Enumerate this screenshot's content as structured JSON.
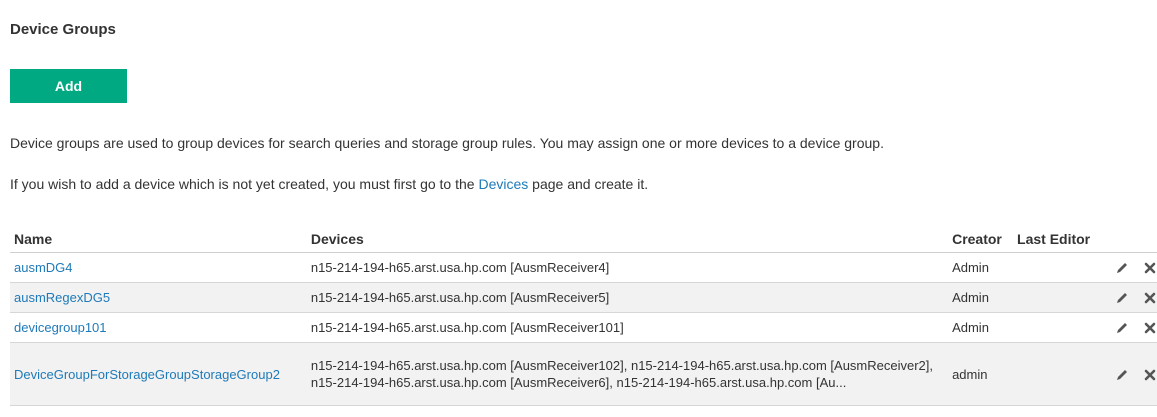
{
  "page": {
    "title": "Device Groups",
    "add_label": "Add",
    "desc1": "Device groups are used to group devices for search queries and storage group rules. You may assign one or more devices to a device group.",
    "desc2_pre": "If you wish to add a device which is not yet created, you must first go to the ",
    "desc2_link": "Devices",
    "desc2_post": " page and create it."
  },
  "table": {
    "headers": {
      "name": "Name",
      "devices": "Devices",
      "creator": "Creator",
      "last_editor": "Last Editor"
    },
    "rows": [
      {
        "name": "ausmDG4",
        "devices": "n15-214-194-h65.arst.usa.hp.com [AusmReceiver4]",
        "creator": "Admin",
        "last_editor": ""
      },
      {
        "name": "ausmRegexDG5",
        "devices": "n15-214-194-h65.arst.usa.hp.com [AusmReceiver5]",
        "creator": "Admin",
        "last_editor": ""
      },
      {
        "name": "devicegroup101",
        "devices": "n15-214-194-h65.arst.usa.hp.com [AusmReceiver101]",
        "creator": "Admin",
        "last_editor": ""
      },
      {
        "name": "DeviceGroupForStorageGroupStorageGroup2",
        "devices": "n15-214-194-h65.arst.usa.hp.com [AusmReceiver102], n15-214-194-h65.arst.usa.hp.com [AusmReceiver2], n15-214-194-h65.arst.usa.hp.com [AusmReceiver6], n15-214-194-h65.arst.usa.hp.com [Au...",
        "creator": "admin",
        "last_editor": ""
      }
    ]
  },
  "icons": {
    "edit": "pencil-icon",
    "delete": "close-icon"
  },
  "colors": {
    "accent": "#01a982",
    "link": "#1e7ab8",
    "row_alt": "#f2f2f2"
  }
}
